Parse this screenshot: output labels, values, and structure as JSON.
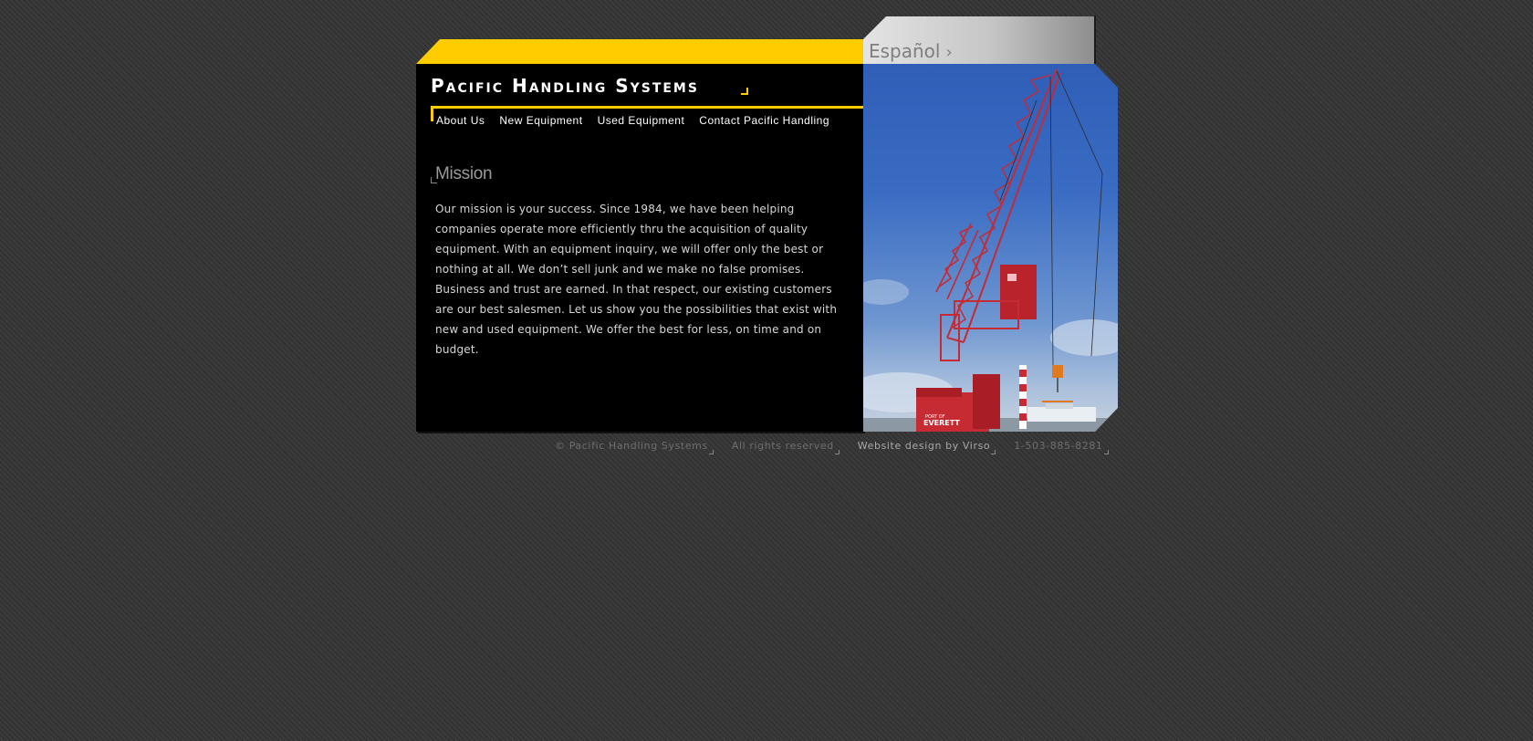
{
  "header": {
    "logo_text": "Pacific Handling Systems",
    "language_link": "Español",
    "language_arrow": "›"
  },
  "nav": {
    "items": [
      {
        "label": "About Us"
      },
      {
        "label": "New Equipment"
      },
      {
        "label": "Used Equipment"
      },
      {
        "label": "Contact Pacific Handling"
      }
    ]
  },
  "main": {
    "section_title": "Mission",
    "body_text": "Our mission is your success.  Since 1984, we have been helping companies operate more efficiently thru the acquisition of quality equipment.  With an equipment inquiry, we will offer only the best or nothing at all.  We don’t sell junk and we make no false promises.  Business and trust are earned.  In that respect, our existing customers are our best salesmen.  Let us show you the possibilities that exist with new and used equipment.  We offer the best for less, on time and on budget."
  },
  "photo": {
    "crane_label": "EVERETT",
    "crane_label_small": "PORT OF"
  },
  "footer": {
    "copyright": "© Pacific Handling Systems",
    "rights": "All rights reserved",
    "design_credit": "Website design by Virso",
    "phone": "1-503-885-8281"
  },
  "colors": {
    "accent_yellow": "#ffcc00",
    "panel_black": "#000000",
    "background": "#3a3a3a",
    "crane_red": "#c62a33"
  }
}
